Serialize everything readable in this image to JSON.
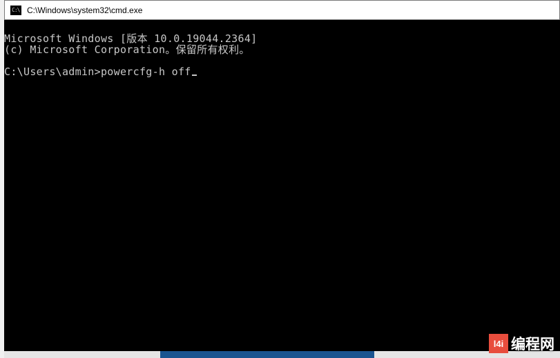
{
  "window": {
    "title": "C:\\Windows\\system32\\cmd.exe"
  },
  "terminal": {
    "line1": "Microsoft Windows [版本 10.0.19044.2364]",
    "line2": "(c) Microsoft Corporation。保留所有权利。",
    "blank": "",
    "prompt": "C:\\Users\\admin>",
    "command": "powercfg-h off"
  },
  "watermark": {
    "logo_text": "l4i",
    "text": "编程网"
  }
}
